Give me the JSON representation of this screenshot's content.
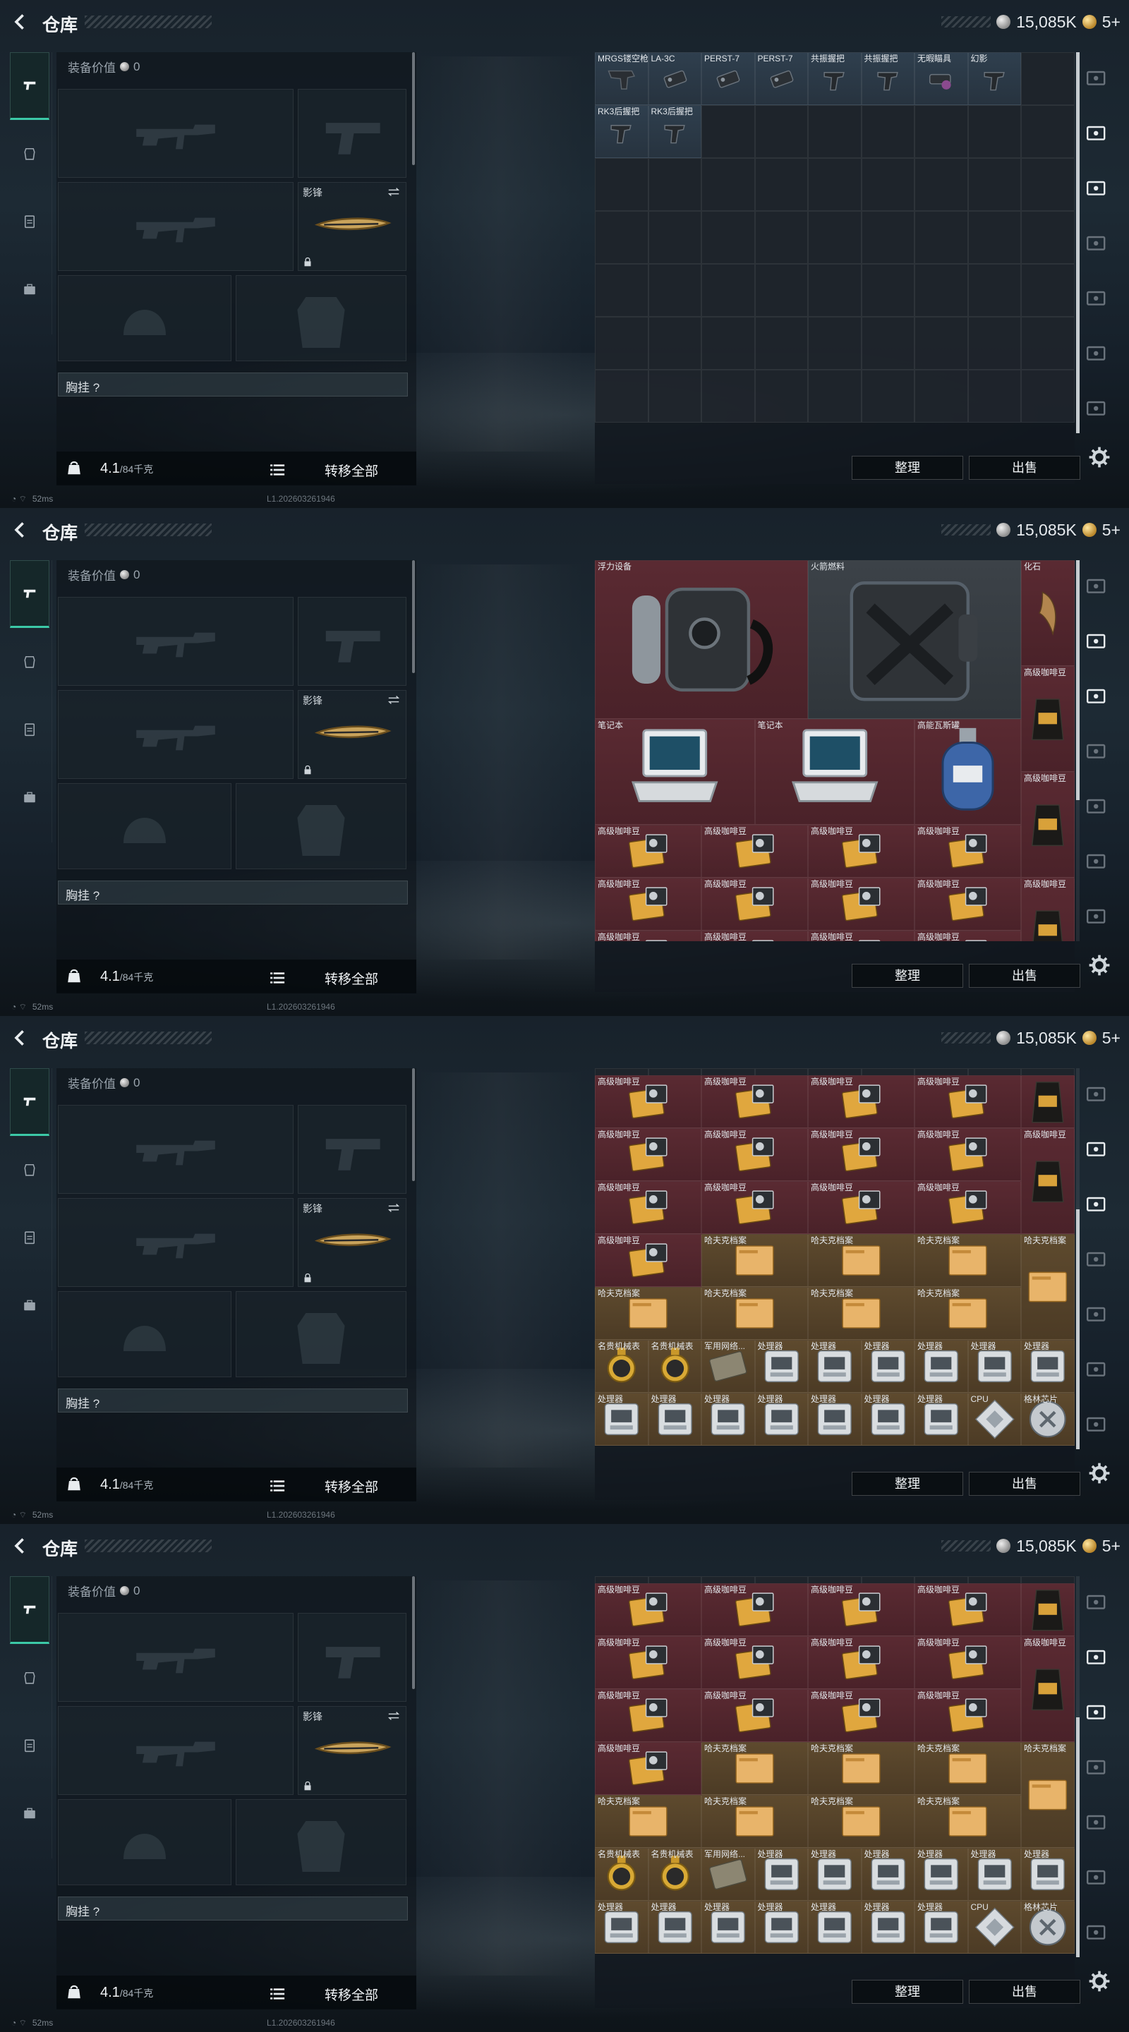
{
  "header": {
    "title": "仓库",
    "silver": "15,085K",
    "gold": "5+"
  },
  "equipment": {
    "value_label": "装备价值",
    "value": "0",
    "melee_label": "影锋",
    "chest_label": "胸挂 ?",
    "weight": "4.1",
    "weight_max": "/84千克",
    "transfer_all": "转移全部"
  },
  "status": {
    "ping": "52ms",
    "build": "L1.202603261946"
  },
  "stash_buttons": {
    "sort": "整理",
    "sell": "出售"
  },
  "frames": [
    {
      "id": "attachments",
      "scroll_fraction": 0.0,
      "items": [
        {
          "label": "MRGS镂空枪托",
          "color": "blue",
          "icon": "stock-icon",
          "col": 0,
          "row": 0
        },
        {
          "label": "LA-3C",
          "color": "blue",
          "icon": "laser-icon",
          "col": 1,
          "row": 0
        },
        {
          "label": "PERST-7",
          "color": "blue",
          "icon": "laser-icon",
          "col": 2,
          "row": 0
        },
        {
          "label": "PERST-7",
          "color": "blue",
          "icon": "laser-icon",
          "col": 3,
          "row": 0
        },
        {
          "label": "共振握把",
          "color": "blue",
          "icon": "grip-icon",
          "col": 4,
          "row": 0
        },
        {
          "label": "共振握把",
          "color": "blue",
          "icon": "grip-icon",
          "col": 5,
          "row": 0
        },
        {
          "label": "无暇瞄具",
          "color": "blue",
          "icon": "sight-icon",
          "col": 6,
          "row": 0
        },
        {
          "label": "幻影",
          "color": "blue",
          "icon": "grip-icon",
          "col": 7,
          "row": 0
        },
        {
          "label": "RK3后握把",
          "color": "blue",
          "icon": "grip-icon",
          "col": 0,
          "row": 1
        },
        {
          "label": "RK3后握把",
          "color": "blue",
          "icon": "grip-icon",
          "col": 1,
          "row": 1
        }
      ]
    },
    {
      "id": "loot-top",
      "scroll_fraction": 0.0,
      "items": [
        {
          "label": "浮力设备",
          "color": "red",
          "icon": "rebreather-icon",
          "col": 0,
          "row": 0,
          "w": 4,
          "h": 3
        },
        {
          "label": "火箭燃料",
          "color": "gray",
          "icon": "jerrycan-icon",
          "col": 4,
          "row": 0,
          "w": 4,
          "h": 3
        },
        {
          "label": "化石",
          "color": "red",
          "icon": "fossil-icon",
          "col": 8,
          "row": 0,
          "w": 1,
          "h": 2
        },
        {
          "label": "高级咖啡豆",
          "color": "red",
          "icon": "coffee-bag-icon",
          "col": 8,
          "row": 2,
          "w": 1,
          "h": 2
        },
        {
          "label": "笔记本",
          "color": "red",
          "icon": "laptop-icon",
          "col": 0,
          "row": 3,
          "w": 3,
          "h": 2
        },
        {
          "label": "笔记本",
          "color": "red",
          "icon": "laptop-icon",
          "col": 3,
          "row": 3,
          "w": 3,
          "h": 2
        },
        {
          "label": "高能瓦斯罐",
          "color": "red",
          "icon": "gas-can-icon",
          "col": 6,
          "row": 3,
          "w": 2,
          "h": 2
        },
        {
          "label": "高级咖啡豆",
          "color": "red",
          "icon": "coffee-bag-icon",
          "col": 8,
          "row": 4,
          "w": 1,
          "h": 2
        },
        {
          "label": "高级咖啡豆",
          "color": "red",
          "icon": "coffee-box-icon",
          "col": 0,
          "row": 5,
          "w": 2,
          "h": 1
        },
        {
          "label": "高级咖啡豆",
          "color": "red",
          "icon": "coffee-box-icon",
          "col": 2,
          "row": 5,
          "w": 2,
          "h": 1
        },
        {
          "label": "高级咖啡豆",
          "color": "red",
          "icon": "coffee-box-icon",
          "col": 4,
          "row": 5,
          "w": 2,
          "h": 1
        },
        {
          "label": "高级咖啡豆",
          "color": "red",
          "icon": "coffee-box-icon",
          "col": 6,
          "row": 5,
          "w": 2,
          "h": 1
        },
        {
          "label": "高级咖啡豆",
          "color": "red",
          "icon": "coffee-box-icon",
          "col": 0,
          "row": 6,
          "w": 2,
          "h": 1
        },
        {
          "label": "高级咖啡豆",
          "color": "red",
          "icon": "coffee-box-icon",
          "col": 2,
          "row": 6,
          "w": 2,
          "h": 1
        },
        {
          "label": "高级咖啡豆",
          "color": "red",
          "icon": "coffee-box-icon",
          "col": 4,
          "row": 6,
          "w": 2,
          "h": 1
        },
        {
          "label": "高级咖啡豆",
          "color": "red",
          "icon": "coffee-box-icon",
          "col": 6,
          "row": 6,
          "w": 2,
          "h": 1
        },
        {
          "label": "高级咖啡豆",
          "color": "red",
          "icon": "coffee-bag-icon",
          "col": 8,
          "row": 6,
          "w": 1,
          "h": 2
        },
        {
          "label": "高级咖啡豆",
          "color": "red",
          "icon": "coffee-box-icon",
          "col": 0,
          "row": 7,
          "w": 2,
          "h": 1
        },
        {
          "label": "高级咖啡豆",
          "color": "red",
          "icon": "coffee-box-icon",
          "col": 2,
          "row": 7,
          "w": 2,
          "h": 1
        },
        {
          "label": "高级咖啡豆",
          "color": "red",
          "icon": "coffee-box-icon",
          "col": 4,
          "row": 7,
          "w": 2,
          "h": 1
        },
        {
          "label": "高级咖啡豆",
          "color": "red",
          "icon": "coffee-box-icon",
          "col": 6,
          "row": 7,
          "w": 2,
          "h": 1
        }
      ]
    },
    {
      "id": "loot-bottom",
      "scroll_fraction": 1.0,
      "items": [
        {
          "label": "高级咖啡豆",
          "color": "red",
          "icon": "coffee-box-icon",
          "col": 0,
          "row": 0,
          "w": 2,
          "h": 1
        },
        {
          "label": "高级咖啡豆",
          "color": "red",
          "icon": "coffee-box-icon",
          "col": 2,
          "row": 0,
          "w": 2,
          "h": 1
        },
        {
          "label": "高级咖啡豆",
          "color": "red",
          "icon": "coffee-box-icon",
          "col": 4,
          "row": 0,
          "w": 2,
          "h": 1
        },
        {
          "label": "高级咖啡豆",
          "color": "red",
          "icon": "coffee-box-icon",
          "col": 6,
          "row": 0,
          "w": 2,
          "h": 1
        },
        {
          "label": "",
          "color": "red",
          "icon": "coffee-bag-icon",
          "col": 8,
          "row": 0,
          "w": 1,
          "h": 1
        },
        {
          "label": "高级咖啡豆",
          "color": "red",
          "icon": "coffee-box-icon",
          "col": 0,
          "row": 1,
          "w": 2,
          "h": 1
        },
        {
          "label": "高级咖啡豆",
          "color": "red",
          "icon": "coffee-box-icon",
          "col": 2,
          "row": 1,
          "w": 2,
          "h": 1
        },
        {
          "label": "高级咖啡豆",
          "color": "red",
          "icon": "coffee-box-icon",
          "col": 4,
          "row": 1,
          "w": 2,
          "h": 1
        },
        {
          "label": "高级咖啡豆",
          "color": "red",
          "icon": "coffee-box-icon",
          "col": 6,
          "row": 1,
          "w": 2,
          "h": 1
        },
        {
          "label": "高级咖啡豆",
          "color": "red",
          "icon": "coffee-bag-icon",
          "col": 8,
          "row": 1,
          "w": 1,
          "h": 2
        },
        {
          "label": "高级咖啡豆",
          "color": "red",
          "icon": "coffee-box-icon",
          "col": 0,
          "row": 2,
          "w": 2,
          "h": 1
        },
        {
          "label": "高级咖啡豆",
          "color": "red",
          "icon": "coffee-box-icon",
          "col": 2,
          "row": 2,
          "w": 2,
          "h": 1
        },
        {
          "label": "高级咖啡豆",
          "color": "red",
          "icon": "coffee-box-icon",
          "col": 4,
          "row": 2,
          "w": 2,
          "h": 1
        },
        {
          "label": "高级咖啡豆",
          "color": "red",
          "icon": "coffee-box-icon",
          "col": 6,
          "row": 2,
          "w": 2,
          "h": 1
        },
        {
          "label": "高级咖啡豆",
          "color": "red",
          "icon": "coffee-box-icon",
          "col": 0,
          "row": 3,
          "w": 2,
          "h": 1
        },
        {
          "label": "哈夫克档案",
          "color": "gold",
          "icon": "document-icon",
          "col": 2,
          "row": 3,
          "w": 2,
          "h": 1
        },
        {
          "label": "哈夫克档案",
          "color": "gold",
          "icon": "document-icon",
          "col": 4,
          "row": 3,
          "w": 2,
          "h": 1
        },
        {
          "label": "哈夫克档案",
          "color": "gold",
          "icon": "document-icon",
          "col": 6,
          "row": 3,
          "w": 2,
          "h": 1
        },
        {
          "label": "哈夫克档案",
          "color": "gold",
          "icon": "document-icon",
          "col": 8,
          "row": 3,
          "w": 1,
          "h": 2
        },
        {
          "label": "哈夫克档案",
          "color": "gold",
          "icon": "document-icon",
          "col": 0,
          "row": 4,
          "w": 2,
          "h": 1
        },
        {
          "label": "哈夫克档案",
          "color": "gold",
          "icon": "document-icon",
          "col": 2,
          "row": 4,
          "w": 2,
          "h": 1
        },
        {
          "label": "哈夫克档案",
          "color": "gold",
          "icon": "document-icon",
          "col": 4,
          "row": 4,
          "w": 2,
          "h": 1
        },
        {
          "label": "哈夫克档案",
          "color": "gold",
          "icon": "document-icon",
          "col": 6,
          "row": 4,
          "w": 2,
          "h": 1
        },
        {
          "label": "名贵机械表",
          "color": "gold",
          "icon": "watch-icon",
          "col": 0,
          "row": 5,
          "w": 1,
          "h": 1
        },
        {
          "label": "名贵机械表",
          "color": "gold",
          "icon": "watch-icon",
          "col": 1,
          "row": 5,
          "w": 1,
          "h": 1
        },
        {
          "label": "军用网络...",
          "color": "gold",
          "icon": "module-icon",
          "col": 2,
          "row": 5,
          "w": 1,
          "h": 1
        },
        {
          "label": "处理器",
          "color": "gold",
          "icon": "processor-icon",
          "col": 3,
          "row": 5,
          "w": 1,
          "h": 1
        },
        {
          "label": "处理器",
          "color": "gold",
          "icon": "processor-icon",
          "col": 4,
          "row": 5,
          "w": 1,
          "h": 1
        },
        {
          "label": "处理器",
          "color": "gold",
          "icon": "processor-icon",
          "col": 5,
          "row": 5,
          "w": 1,
          "h": 1
        },
        {
          "label": "处理器",
          "color": "gold",
          "icon": "processor-icon",
          "col": 6,
          "row": 5,
          "w": 1,
          "h": 1
        },
        {
          "label": "处理器",
          "color": "gold",
          "icon": "processor-icon",
          "col": 7,
          "row": 5,
          "w": 1,
          "h": 1
        },
        {
          "label": "处理器",
          "color": "gold",
          "icon": "processor-icon",
          "col": 8,
          "row": 5,
          "w": 1,
          "h": 1
        },
        {
          "label": "处理器",
          "color": "gold",
          "icon": "processor-icon",
          "col": 0,
          "row": 6,
          "w": 1,
          "h": 1
        },
        {
          "label": "处理器",
          "color": "gold",
          "icon": "processor-icon",
          "col": 1,
          "row": 6,
          "w": 1,
          "h": 1
        },
        {
          "label": "处理器",
          "color": "gold",
          "icon": "processor-icon",
          "col": 2,
          "row": 6,
          "w": 1,
          "h": 1
        },
        {
          "label": "处理器",
          "color": "gold",
          "icon": "processor-icon",
          "col": 3,
          "row": 6,
          "w": 1,
          "h": 1
        },
        {
          "label": "处理器",
          "color": "gold",
          "icon": "processor-icon",
          "col": 4,
          "row": 6,
          "w": 1,
          "h": 1
        },
        {
          "label": "处理器",
          "color": "gold",
          "icon": "processor-icon",
          "col": 5,
          "row": 6,
          "w": 1,
          "h": 1
        },
        {
          "label": "处理器",
          "color": "gold",
          "icon": "processor-icon",
          "col": 6,
          "row": 6,
          "w": 1,
          "h": 1
        },
        {
          "label": "CPU",
          "color": "gold",
          "icon": "cpu-icon",
          "col": 7,
          "row": 6,
          "w": 1,
          "h": 1
        },
        {
          "label": "格林芯片",
          "color": "gold",
          "icon": "chip-icon",
          "col": 8,
          "row": 6,
          "w": 1,
          "h": 1
        }
      ]
    }
  ],
  "frame_order": [
    0,
    1,
    2,
    2
  ]
}
